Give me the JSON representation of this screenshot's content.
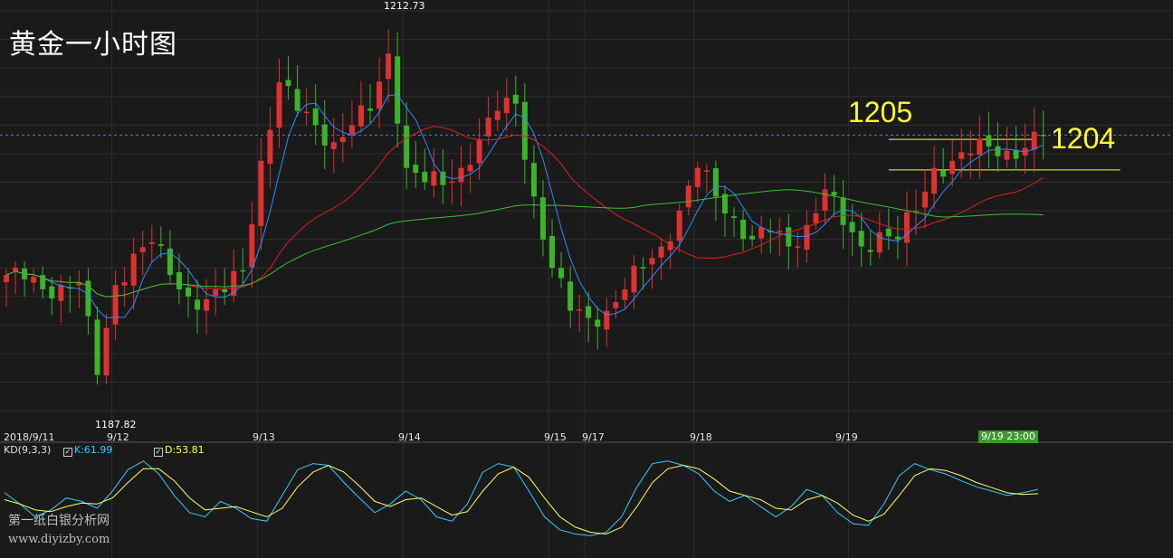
{
  "title": "黄金一小时图",
  "level_labels": {
    "upper": "1205",
    "lower": "1204"
  },
  "colors": {
    "background": "#1a1a1a",
    "grid": "#2e2e2e",
    "bull": "#e03030",
    "bear": "#3cb32a",
    "ma_fast": "#2e8bff",
    "ma_mid": "#e02020",
    "ma_slow": "#38c038",
    "k_line": "#33ccff",
    "d_line": "#ffff66",
    "level": "#ffff33",
    "current_price": "#4a7adf"
  },
  "x_axis": {
    "labels": [
      "2018/9/11",
      "9/12",
      "9/13",
      "9/14",
      "9/15",
      "9/17",
      "9/18",
      "9/19"
    ]
  },
  "cursor_label": "9/19 23:00",
  "annotations": {
    "high": "1212.73",
    "low": "1187.82"
  },
  "indicator": {
    "name": "KD(9,3,3)",
    "k_label": "K:61.99",
    "d_label": "D:53.81"
  },
  "watermark": {
    "name": "第一纸白银分析网",
    "url": "www.diyizby.com"
  },
  "chart_data": {
    "type": "candlestick",
    "title": "黄金一小时图",
    "price_range": [
      1185.5,
      1214
    ],
    "levels": [
      1205,
      1204
    ],
    "current_price": 1205.3,
    "high": {
      "value": 1212.73,
      "index": 42
    },
    "low": {
      "value": 1187.82,
      "index": 10
    },
    "date_labels": [
      {
        "label": "2018/9/11",
        "index": 0
      },
      {
        "label": "9/12",
        "index": 12
      },
      {
        "label": "9/13",
        "index": 28
      },
      {
        "label": "9/14",
        "index": 44
      },
      {
        "label": "9/15",
        "index": 60
      },
      {
        "label": "9/17",
        "index": 64
      },
      {
        "label": "9/18",
        "index": 76
      },
      {
        "label": "9/19",
        "index": 93
      },
      {
        "label": "9/19 23:00",
        "index": 114
      }
    ],
    "close_anchors": [
      [
        0,
        1195.5
      ],
      [
        2,
        1195.2
      ],
      [
        4,
        1194.5
      ],
      [
        6,
        1194.8
      ],
      [
        8,
        1195.0
      ],
      [
        10,
        1188.5
      ],
      [
        12,
        1194.8
      ],
      [
        14,
        1197.0
      ],
      [
        16,
        1197.8
      ],
      [
        18,
        1195.5
      ],
      [
        20,
        1194.0
      ],
      [
        22,
        1193.8
      ],
      [
        24,
        1194.3
      ],
      [
        26,
        1195.8
      ],
      [
        28,
        1203.5
      ],
      [
        30,
        1209.0
      ],
      [
        32,
        1207.0
      ],
      [
        34,
        1206.0
      ],
      [
        36,
        1204.8
      ],
      [
        38,
        1206.0
      ],
      [
        40,
        1207.0
      ],
      [
        42,
        1211.0
      ],
      [
        44,
        1203.0
      ],
      [
        46,
        1202.0
      ],
      [
        48,
        1201.8
      ],
      [
        50,
        1203.0
      ],
      [
        52,
        1205.0
      ],
      [
        54,
        1207.0
      ],
      [
        56,
        1207.5
      ],
      [
        58,
        1201.0
      ],
      [
        60,
        1196.0
      ],
      [
        62,
        1193.0
      ],
      [
        64,
        1192.5
      ],
      [
        66,
        1193.0
      ],
      [
        68,
        1194.5
      ],
      [
        70,
        1196.0
      ],
      [
        72,
        1197.5
      ],
      [
        74,
        1200.0
      ],
      [
        76,
        1203.0
      ],
      [
        78,
        1201.0
      ],
      [
        80,
        1199.5
      ],
      [
        82,
        1198.0
      ],
      [
        84,
        1198.5
      ],
      [
        86,
        1197.5
      ],
      [
        88,
        1199.0
      ],
      [
        90,
        1201.5
      ],
      [
        92,
        1199.0
      ],
      [
        94,
        1197.5
      ],
      [
        96,
        1198.5
      ],
      [
        98,
        1198.0
      ],
      [
        100,
        1200.0
      ],
      [
        102,
        1203.0
      ],
      [
        104,
        1203.5
      ],
      [
        106,
        1204.0
      ],
      [
        108,
        1204.5
      ],
      [
        110,
        1204.2
      ],
      [
        112,
        1204.4
      ],
      [
        114,
        1205.3
      ]
    ],
    "kd": {
      "range": [
        0,
        100
      ],
      "k": [
        58,
        45,
        30,
        38,
        52,
        48,
        40,
        60,
        85,
        95,
        80,
        55,
        35,
        30,
        48,
        40,
        28,
        25,
        55,
        85,
        92,
        90,
        70,
        52,
        35,
        45,
        60,
        50,
        30,
        25,
        45,
        82,
        92,
        88,
        60,
        30,
        15,
        10,
        8,
        12,
        30,
        65,
        92,
        95,
        90,
        80,
        60,
        48,
        55,
        42,
        30,
        42,
        62,
        55,
        35,
        22,
        20,
        45,
        78,
        92,
        85,
        80,
        72,
        65,
        60,
        55,
        58,
        62
      ],
      "d": [
        50,
        45,
        38,
        36,
        42,
        46,
        45,
        52,
        70,
        86,
        86,
        72,
        52,
        38,
        40,
        42,
        36,
        30,
        40,
        65,
        82,
        90,
        82,
        66,
        48,
        42,
        50,
        52,
        42,
        32,
        36,
        60,
        80,
        88,
        76,
        52,
        30,
        18,
        12,
        10,
        18,
        42,
        70,
        86,
        90,
        86,
        74,
        60,
        55,
        50,
        40,
        38,
        50,
        55,
        46,
        32,
        25,
        33,
        55,
        78,
        86,
        84,
        78,
        70,
        64,
        58,
        56,
        57
      ]
    }
  }
}
